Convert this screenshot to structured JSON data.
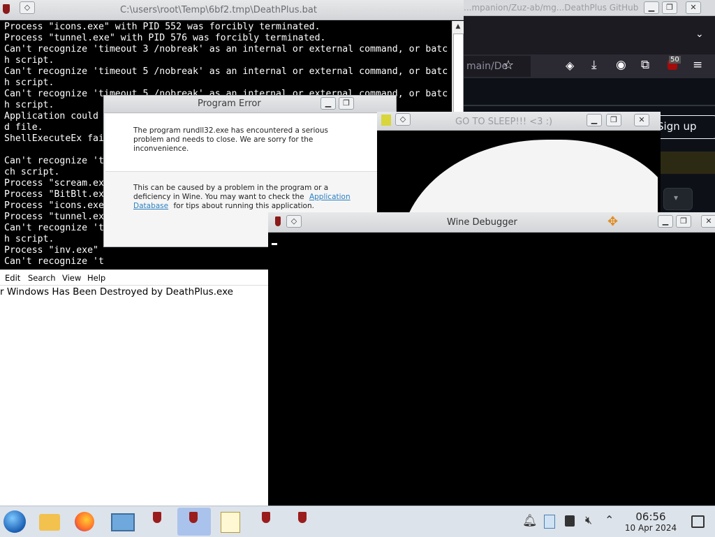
{
  "firefox": {
    "title": "...mpanion/Zuz-ab/mg...DeathPlus  GitHub — Mozilla Firefox",
    "url_fragment": "main/De",
    "notification_count": "50",
    "signup_label": "Sign up"
  },
  "batch": {
    "title": "C:\\users\\root\\Temp\\6bf2.tmp\\DeathPlus.bat",
    "lines": [
      "Process \"icons.exe\" with PID 552 was forcibly terminated.",
      "Process \"tunnel.exe\" with PID 576 was forcibly terminated.",
      "Can't recognize 'timeout 3 /nobreak' as an internal or external command, or batc",
      "h script.",
      "Can't recognize 'timeout 5 /nobreak' as an internal or external command, or batc",
      "h script.",
      "Can't recognize 'timeout 5 /nobreak' as an internal or external command, or batc",
      "h script.",
      "Application could",
      "d file.",
      "ShellExecuteEx fai",
      "",
      "Can't recognize 't",
      "ch script.",
      "Process \"scream.ex",
      "Process \"BitBlt.ex",
      "Process \"icons.exe",
      "Process \"tunnel.ex",
      "Can't recognize 't",
      "h script.",
      "Process \"inv.exe\"",
      "Can't recognize 't"
    ]
  },
  "notepad": {
    "menu": [
      "Edit",
      "Search",
      "View",
      "Help"
    ],
    "content": "r Windows Has Been Destroyed by DeathPlus.exe"
  },
  "program_error": {
    "title": "Program Error",
    "message": "The program rundll32.exe has encountered a serious problem and needs to close. We are sorry for the inconvenience.",
    "detail_prefix": "This can be caused by a problem in the program or a deficiency in Wine. You may want to check the",
    "link": "Application Database",
    "detail_suffix": "for tips about running this application."
  },
  "sleep_window": {
    "title": "GO TO SLEEP!!! <3 :)"
  },
  "wine_debugger": {
    "title": "Wine Debugger"
  },
  "taskbar": {
    "time": "06:56",
    "date": "10 Apr 2024"
  },
  "colors": {
    "taskbar_bg": "#dde3ea",
    "active_task": "#aac3ec",
    "link": "#2a7fc1"
  }
}
